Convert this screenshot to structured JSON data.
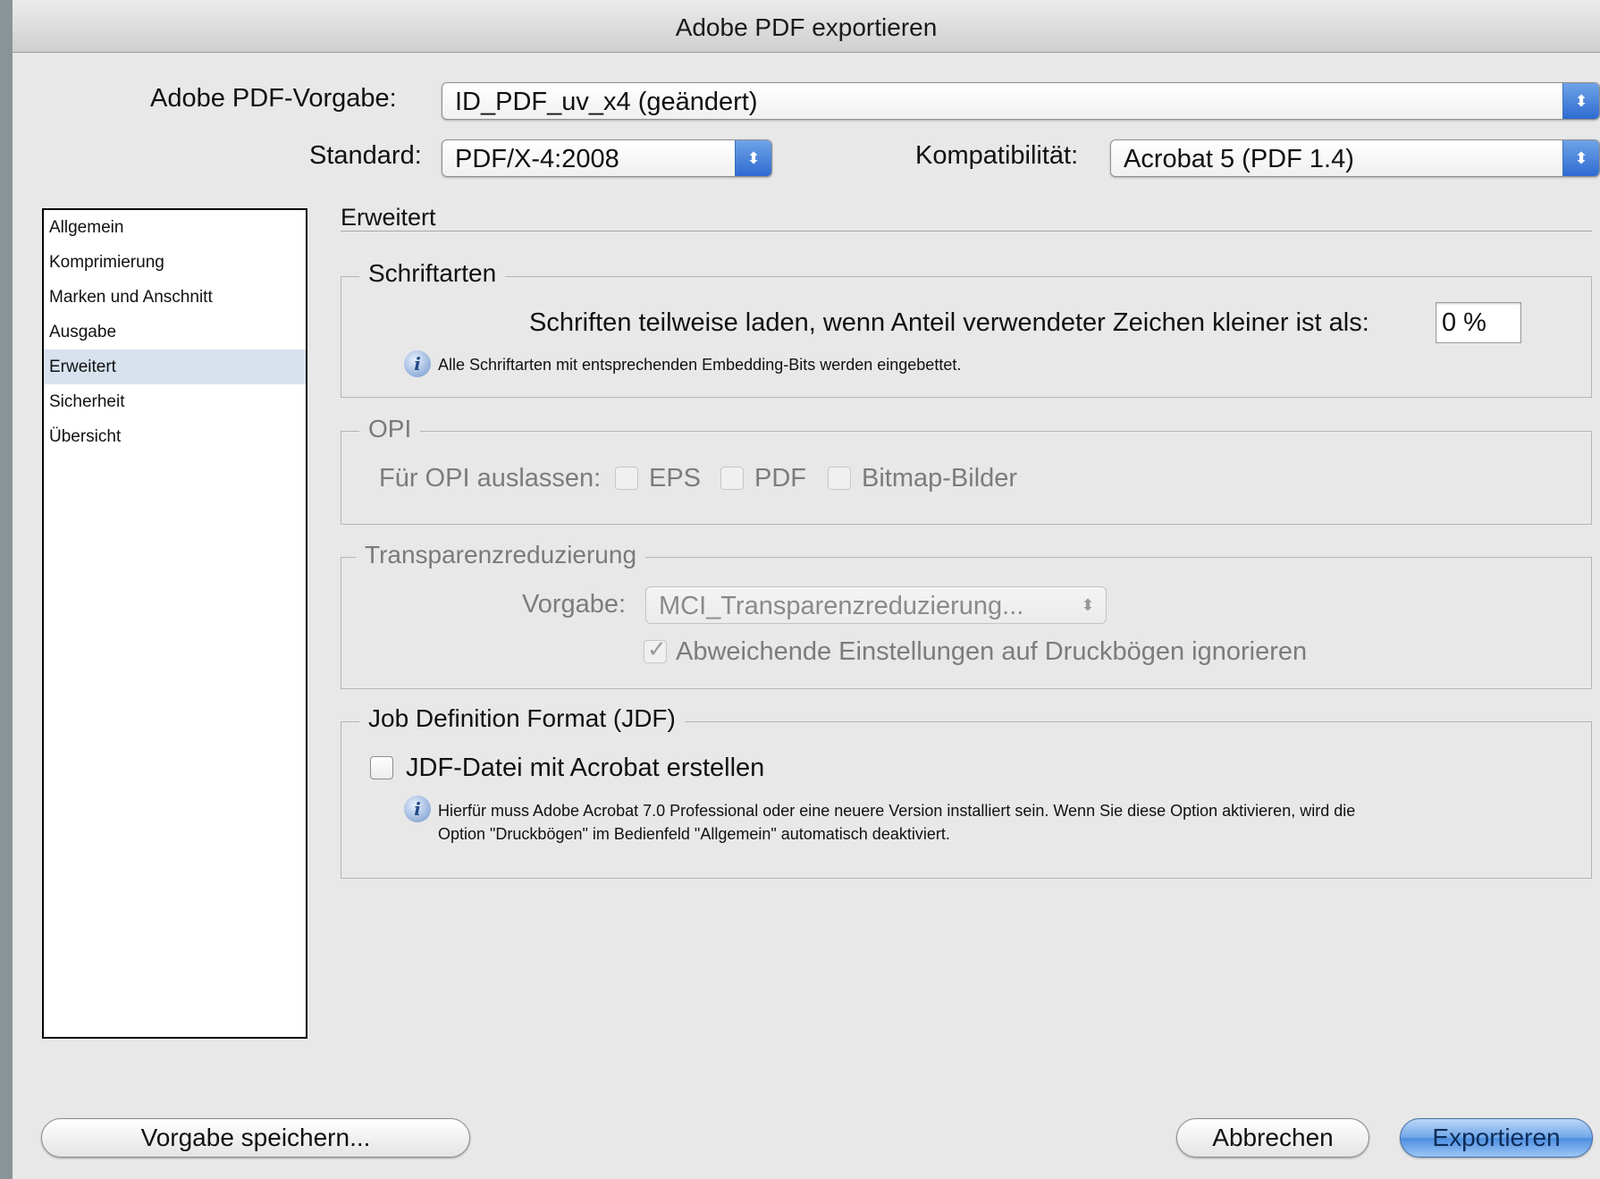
{
  "window": {
    "title": "Adobe PDF exportieren"
  },
  "header": {
    "preset_label": "Adobe PDF-Vorgabe:",
    "preset_value": "ID_PDF_uv_x4 (geändert)",
    "standard_label": "Standard:",
    "standard_value": "PDF/X-4:2008",
    "compat_label": "Kompatibilität:",
    "compat_value": "Acrobat 5 (PDF 1.4)"
  },
  "sidebar": {
    "items": [
      {
        "label": "Allgemein"
      },
      {
        "label": "Komprimierung"
      },
      {
        "label": "Marken und Anschnitt"
      },
      {
        "label": "Ausgabe"
      },
      {
        "label": "Erweitert",
        "selected": true
      },
      {
        "label": "Sicherheit"
      },
      {
        "label": "Übersicht"
      }
    ]
  },
  "main": {
    "title": "Erweitert",
    "fonts": {
      "legend": "Schriftarten",
      "subset_label": "Schriften teilweise laden, wenn Anteil verwendeter Zeichen kleiner ist als:",
      "subset_value": "0 %",
      "info": "Alle Schriftarten mit entsprechenden Embedding-Bits werden eingebettet."
    },
    "opi": {
      "legend": "OPI",
      "omit_label": "Für OPI auslassen:",
      "eps": "EPS",
      "pdf": "PDF",
      "bitmap": "Bitmap-Bilder"
    },
    "transparency": {
      "legend": "Transparenzreduzierung",
      "preset_label": "Vorgabe:",
      "preset_value": "MCI_Transparenzreduzierung...",
      "ignore_label": "Abweichende Einstellungen auf Druckbögen ignorieren",
      "ignore_checked": true
    },
    "jdf": {
      "legend": "Job Definition Format (JDF)",
      "create_label": "JDF-Datei mit Acrobat erstellen",
      "create_checked": false,
      "info_line1": "Hierfür muss Adobe Acrobat 7.0 Professional oder eine neuere Version installiert sein. Wenn Sie diese Option aktivieren, wird die",
      "info_line2": "Option \"Druckbögen\" im Bedienfeld \"Allgemein\" automatisch deaktiviert."
    }
  },
  "footer": {
    "save_preset": "Vorgabe speichern...",
    "cancel": "Abbrechen",
    "export": "Exportieren"
  },
  "colors": {
    "accent": "#4c8ee2",
    "selection": "#d8e2ef"
  }
}
